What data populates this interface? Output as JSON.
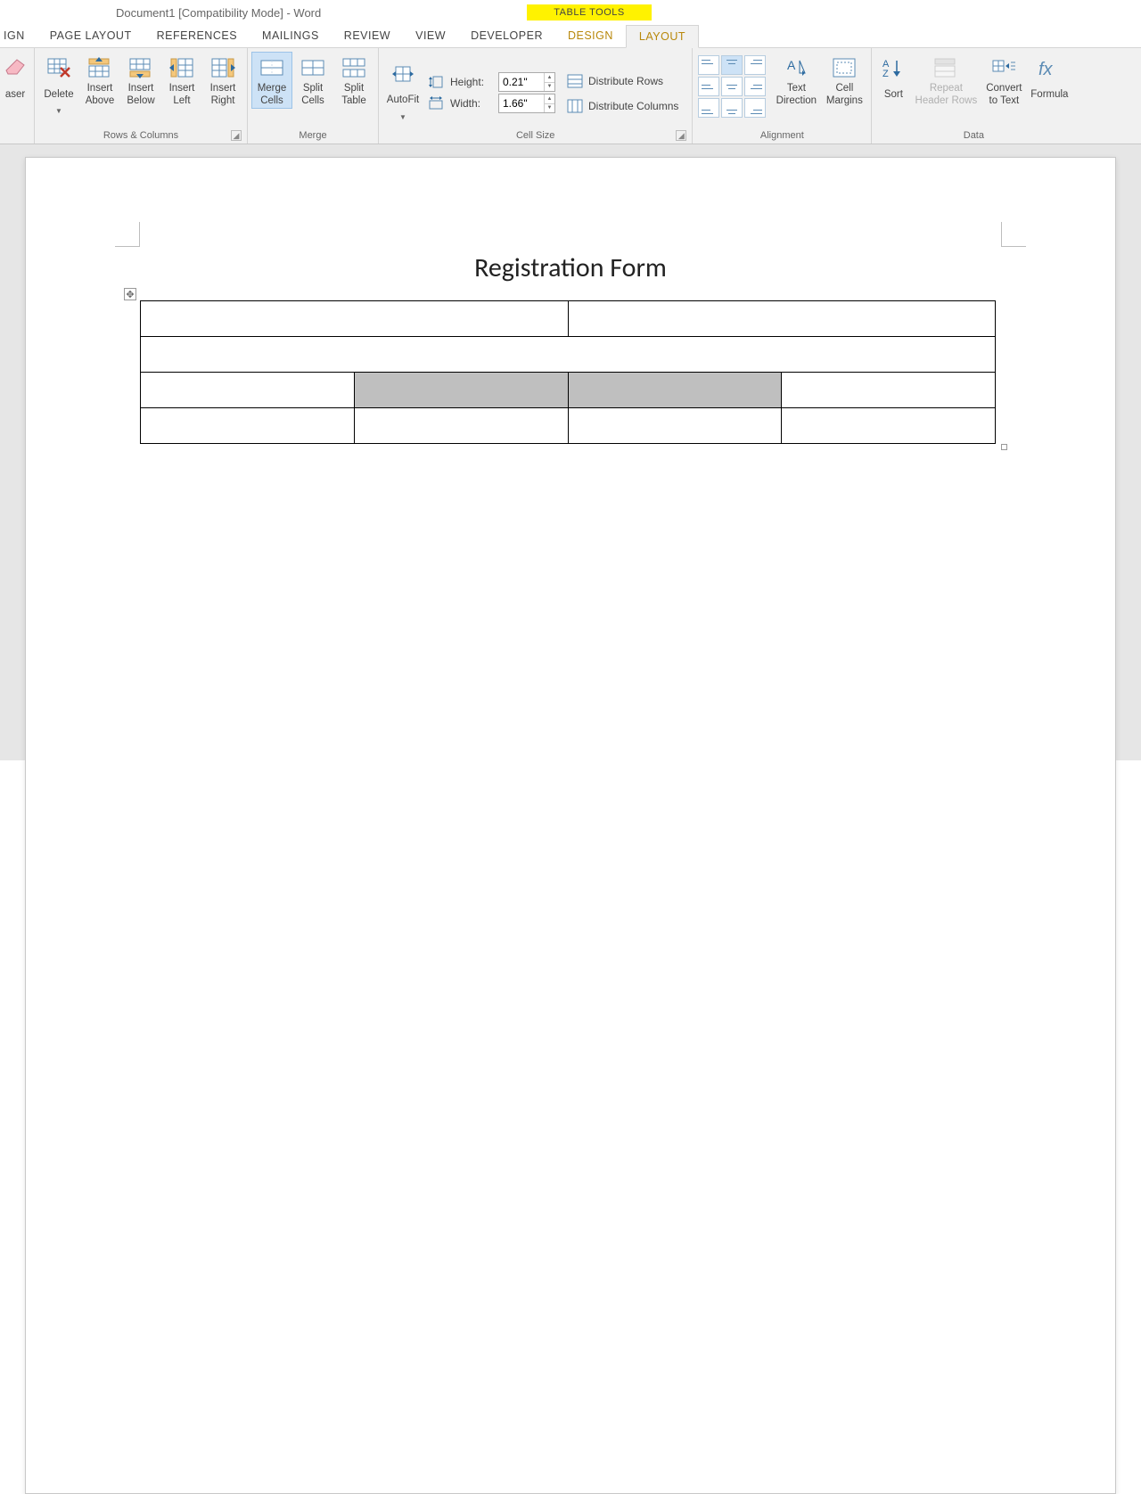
{
  "title": "Document1 [Compatibility Mode] - Word",
  "context_tab_group": "TABLE TOOLS",
  "tabs": [
    "IGN",
    "PAGE LAYOUT",
    "REFERENCES",
    "MAILINGS",
    "REVIEW",
    "VIEW",
    "DEVELOPER",
    "DESIGN",
    "LAYOUT"
  ],
  "active_tab": "LAYOUT",
  "ribbon": {
    "draw": {
      "eraser": "aser"
    },
    "rows_cols": {
      "label": "Rows & Columns",
      "delete": "Delete",
      "insert_above": "Insert\nAbove",
      "insert_below": "Insert\nBelow",
      "insert_left": "Insert\nLeft",
      "insert_right": "Insert\nRight"
    },
    "merge": {
      "label": "Merge",
      "merge_cells": "Merge\nCells",
      "split_cells": "Split\nCells",
      "split_table": "Split\nTable"
    },
    "cell_size": {
      "label": "Cell Size",
      "autofit": "AutoFit",
      "height_label": "Height:",
      "height_value": "0.21\"",
      "width_label": "Width:",
      "width_value": "1.66\"",
      "dist_rows": "Distribute Rows",
      "dist_cols": "Distribute Columns"
    },
    "alignment": {
      "label": "Alignment",
      "text_direction": "Text\nDirection",
      "cell_margins": "Cell\nMargins"
    },
    "data": {
      "label": "Data",
      "sort": "Sort",
      "repeat_header": "Repeat\nHeader Rows",
      "convert": "Convert\nto Text",
      "formula": "Formula"
    }
  },
  "document": {
    "heading": "Registration Form"
  }
}
